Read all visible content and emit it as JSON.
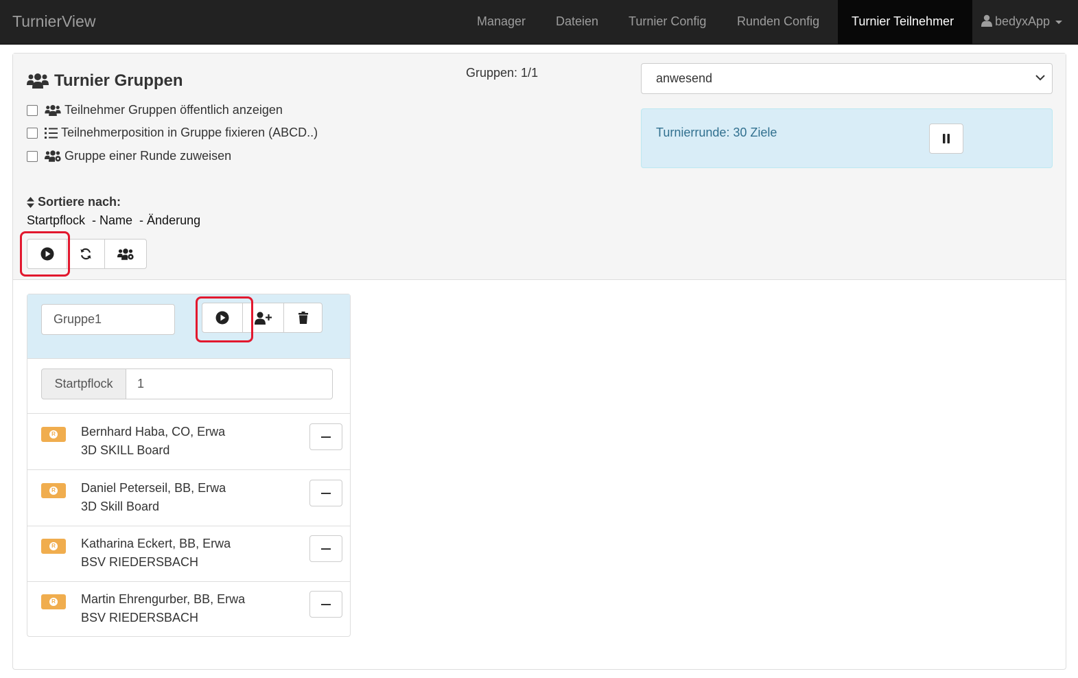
{
  "navbar": {
    "brand": "TurnierView",
    "items": [
      {
        "label": "Manager"
      },
      {
        "label": "Dateien"
      },
      {
        "label": "Turnier Config"
      },
      {
        "label": "Runden Config"
      },
      {
        "label": "Turnier Teilnehmer",
        "active": true
      }
    ],
    "user": {
      "label": "bedyxApp",
      "icon": "user-icon"
    }
  },
  "header": {
    "title": "Turnier Gruppen",
    "title_icon": "users-icon",
    "options": [
      {
        "label": "Teilnehmer Gruppen öffentlich anzeigen",
        "icon": "users-icon",
        "checked": false
      },
      {
        "label": "Teilnehmerposition in Gruppe fixieren (ABCD..)",
        "icon": "ordered-list-icon",
        "checked": false
      },
      {
        "label": "Gruppe einer Runde zuweisen",
        "icon": "users-cog-icon",
        "checked": false
      }
    ],
    "sort_label": "Sortiere nach:",
    "sort_options": "Startpflock  - Name  - Änderung",
    "toolbar": [
      "play-icon",
      "refresh-icon",
      "users-cog-icon"
    ],
    "group_count": "Gruppen: 1/1",
    "status_select": {
      "value": "anwesend"
    },
    "round_info": "Turnierrunde: 30 Ziele",
    "round_button_icon": "pause-icon"
  },
  "group": {
    "name": "Gruppe1",
    "actions": [
      "play-icon",
      "user-plus-icon",
      "trash-icon"
    ],
    "start_label": "Startpflock",
    "start_value": "1",
    "badge_letter": "R",
    "members": [
      {
        "name": "Bernhard Haba, CO, Erwa",
        "club": "3D SKILL Board"
      },
      {
        "name": "Daniel Peterseil, BB, Erwa",
        "club": "3D Skill Board"
      },
      {
        "name": "Katharina Eckert, BB, Erwa",
        "club": "BSV RIEDERSBACH"
      },
      {
        "name": "Martin Ehrengurber, BB, Erwa",
        "club": "BSV RIEDERSBACH"
      }
    ]
  },
  "colors": {
    "navbar_bg": "#222222",
    "nav_active_bg": "#080808",
    "info_bg": "#d9edf7",
    "info_text": "#31708f",
    "badge_bg": "#f0ad4e",
    "highlight": "#e2182e"
  }
}
